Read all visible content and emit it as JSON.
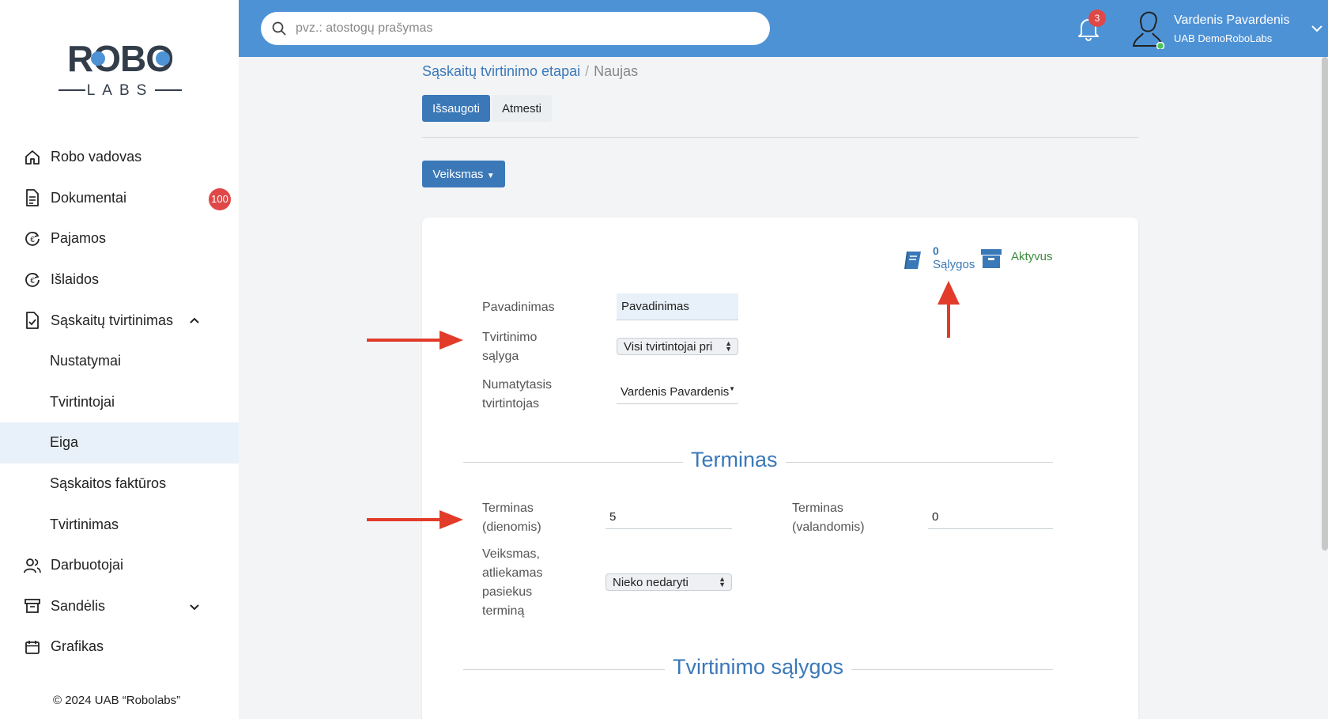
{
  "sidebar": {
    "logo_top": "ROBO",
    "logo_bottom": "LABS",
    "items": [
      {
        "label": "Robo vadovas",
        "icon": "home-icon"
      },
      {
        "label": "Dokumentai",
        "icon": "document-icon",
        "badge": "100"
      },
      {
        "label": "Pajamos",
        "icon": "income-icon"
      },
      {
        "label": "Išlaidos",
        "icon": "expense-icon"
      },
      {
        "label": "Sąskaitų tvirtinimas",
        "icon": "invoice-check-icon",
        "expanded": true
      },
      {
        "label": "Nustatymai"
      },
      {
        "label": "Tvirtintojai"
      },
      {
        "label": "Eiga",
        "active": true
      },
      {
        "label": "Sąskaitos faktūros"
      },
      {
        "label": "Tvirtinimas"
      },
      {
        "label": "Darbuotojai",
        "icon": "users-icon"
      },
      {
        "label": "Sandėlis",
        "icon": "warehouse-icon",
        "expanded": false
      },
      {
        "label": "Grafikas",
        "icon": "calendar-icon"
      }
    ],
    "copyright": "© 2024 UAB “Robolabs”"
  },
  "topbar": {
    "search_placeholder": "pvz.: atostogų prašymas",
    "notifications_count": "3",
    "user_name": "Vardenis Pavardenis",
    "company": "UAB DemoRoboLabs"
  },
  "breadcrumb": {
    "parent": "Sąskaitų tvirtinimo etapai",
    "separator": "/",
    "current": "Naujas"
  },
  "actions": {
    "save": "Išsaugoti",
    "discard": "Atmesti",
    "action_menu": "Veiksmas"
  },
  "card": {
    "conditions_count": "0",
    "conditions_label": "Sąlygos",
    "active_label": "Aktyvus",
    "name_label": "Pavadinimas",
    "name_value": "Pavadinimas",
    "condition_label_1": "Tvirtinimo",
    "condition_label_2": "sąlyga",
    "condition_value": "Visi tvirtintojai pri",
    "default_approver_label_1": "Numatytasis",
    "default_approver_label_2": "tvirtintojas",
    "default_approver_value": "Vardenis Pavardenis",
    "deadline_section": "Terminas",
    "deadline_days_label_1": "Terminas",
    "deadline_days_label_2": "(dienomis)",
    "deadline_days_value": "5",
    "deadline_hours_label_1": "Terminas",
    "deadline_hours_label_2": "(valandomis)",
    "deadline_hours_value": "0",
    "action_on_deadline_label_1": "Veiksmas,",
    "action_on_deadline_label_2": "atliekamas",
    "action_on_deadline_label_3": "pasiekus",
    "action_on_deadline_label_4": "terminą",
    "action_on_deadline_value": "Nieko nedaryti",
    "conditions_section": "Tvirtinimo sąlygos"
  },
  "colors": {
    "topbar": "#4e92d6",
    "primary": "#3a78b8",
    "badge": "#e04848",
    "active_green": "#3c8a3c",
    "annotation_arrow": "#e23b2a"
  }
}
